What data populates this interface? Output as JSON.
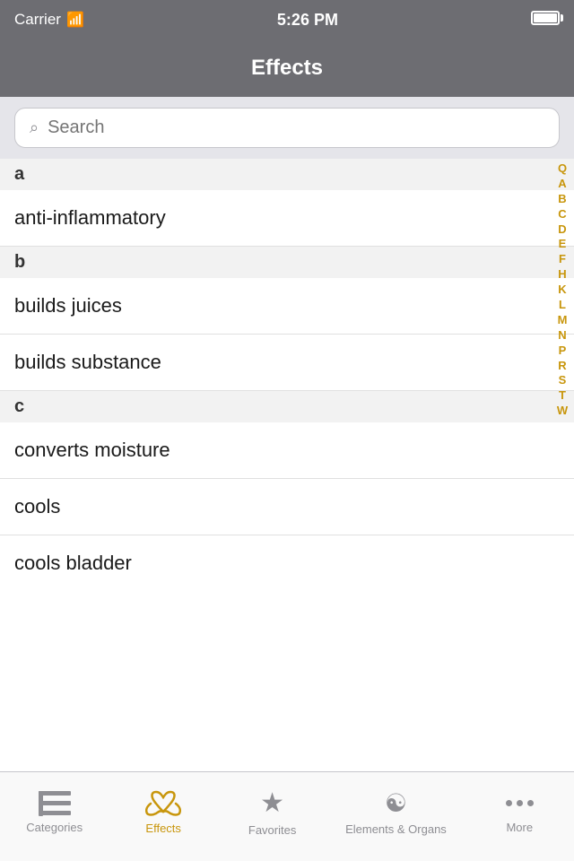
{
  "statusBar": {
    "carrier": "Carrier",
    "time": "5:26 PM"
  },
  "navBar": {
    "title": "Effects"
  },
  "search": {
    "placeholder": "Search"
  },
  "indexLetters": [
    "Q",
    "A",
    "B",
    "C",
    "D",
    "E",
    "F",
    "H",
    "K",
    "L",
    "M",
    "N",
    "P",
    "R",
    "S",
    "T",
    "W"
  ],
  "sections": [
    {
      "letter": "a",
      "items": [
        "anti-inflammatory"
      ]
    },
    {
      "letter": "b",
      "items": [
        "builds juices",
        "builds substance"
      ]
    },
    {
      "letter": "c",
      "items": [
        "converts moisture",
        "cools",
        "cools bladder"
      ]
    }
  ],
  "tabBar": {
    "tabs": [
      {
        "id": "categories",
        "label": "Categories",
        "active": false
      },
      {
        "id": "effects",
        "label": "Effects",
        "active": true
      },
      {
        "id": "favorites",
        "label": "Favorites",
        "active": false
      },
      {
        "id": "elements-organs",
        "label": "Elements & Organs",
        "active": false
      },
      {
        "id": "more",
        "label": "More",
        "active": false
      }
    ]
  }
}
